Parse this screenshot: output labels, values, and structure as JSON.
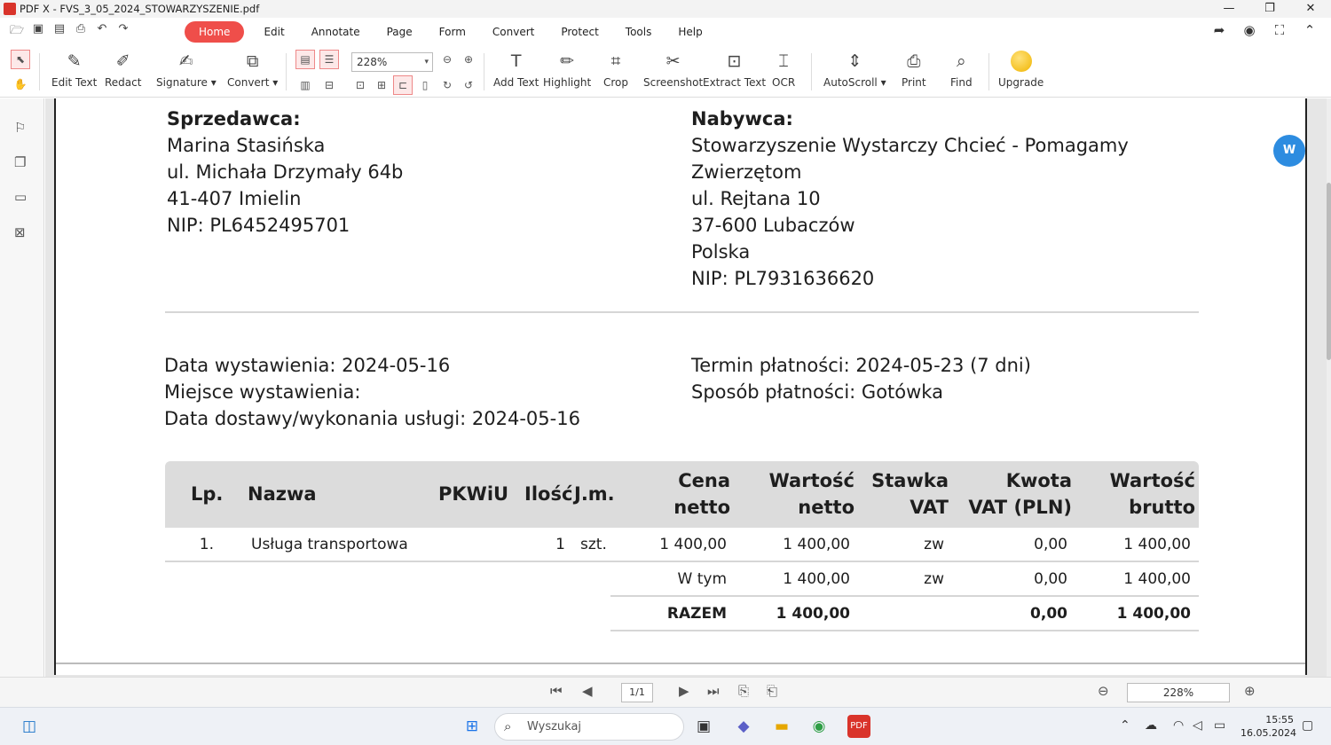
{
  "window": {
    "title": "PDF X - FVS_3_05_2024_STOWARZYSZENIE.pdf",
    "controls": [
      "—",
      "❐",
      "✕"
    ]
  },
  "menu": {
    "tabs": [
      "Home",
      "Edit",
      "Annotate",
      "Page",
      "Form",
      "Convert",
      "Protect",
      "Tools",
      "Help"
    ],
    "active_tab": "Home"
  },
  "toolbar": {
    "edit_text": "Edit Text",
    "redact": "Redact",
    "signature": "Signature ▾",
    "convert": "Convert ▾",
    "zoom_value": "228%",
    "add_text": "Add Text",
    "highlight": "Highlight",
    "crop": "Crop",
    "screenshot": "Screenshot",
    "extract_text": "Extract Text",
    "ocr": "OCR",
    "autoscroll": "AutoScroll ▾",
    "print": "Print",
    "find": "Find",
    "upgrade": "Upgrade"
  },
  "document": {
    "seller": {
      "heading": "Sprzedawca:",
      "lines": [
        "Marina Stasińska",
        "ul. Michała Drzymały 64b",
        "41-407 Imielin",
        "NIP: PL6452495701"
      ]
    },
    "buyer": {
      "heading": "Nabywca:",
      "lines": [
        "Stowarzyszenie Wystarczy Chcieć - Pomagamy",
        "Zwierzętom",
        "ul. Rejtana 10",
        "37-600 Lubaczów",
        "Polska",
        "NIP: PL7931636620"
      ]
    },
    "dates_left": [
      "Data wystawienia: 2024-05-16",
      "Miejsce wystawienia:",
      "Data dostawy/wykonania usługi: 2024-05-16"
    ],
    "dates_right": [
      "Termin płatności: 2024-05-23 (7 dni)",
      "Sposób płatności: Gotówka"
    ],
    "table": {
      "headers": {
        "lp": "Lp.",
        "nazwa": "Nazwa",
        "pkwiu": "PKWiU",
        "ilosc": "Ilość",
        "jm": "J.m.",
        "cena_1": "Cena",
        "cena_2": "netto",
        "wartosc_netto_1": "Wartość",
        "wartosc_netto_2": "netto",
        "stawka_1": "Stawka",
        "stawka_2": "VAT",
        "kwota_1": "Kwota",
        "kwota_2": "VAT (PLN)",
        "wartosc_brutto_1": "Wartość",
        "wartosc_brutto_2": "brutto"
      },
      "row": {
        "lp": "1.",
        "nazwa": "Usługa transportowa",
        "ilosc": "1",
        "jm": "szt.",
        "cena": "1 400,00",
        "wartosc_netto": "1 400,00",
        "stawka": "zw",
        "kwota": "0,00",
        "wartosc_brutto": "1 400,00"
      },
      "w_tym": {
        "label": "W tym",
        "wartosc_netto": "1 400,00",
        "stawka": "zw",
        "kwota": "0,00",
        "wartosc_brutto": "1 400,00"
      },
      "razem": {
        "label": "RAZEM",
        "wartosc_netto": "1 400,00",
        "kwota": "0,00",
        "wartosc_brutto": "1 400,00"
      }
    }
  },
  "bottom_nav": {
    "page": "1/1",
    "zoom": "228%"
  },
  "taskbar": {
    "search_placeholder": "Wyszukaj",
    "time": "15:55",
    "date": "16.05.2024"
  },
  "colors": {
    "accent": "#ef4e4a",
    "table_header_bg": "#dcdcdc"
  }
}
